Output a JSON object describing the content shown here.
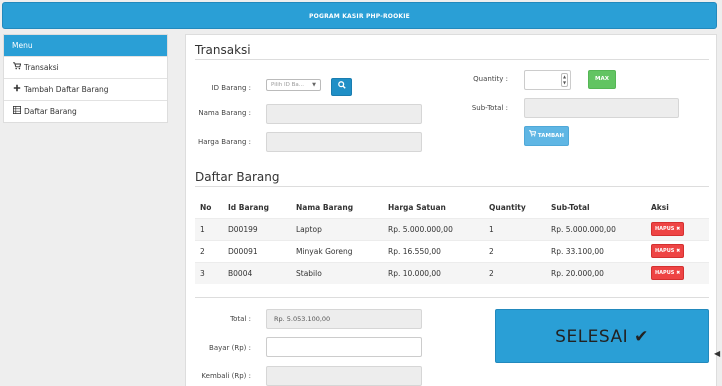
{
  "header": {
    "title": "POGRAM KASIR PHP-ROOKIE"
  },
  "sidebar": {
    "heading": "Menu",
    "items": [
      {
        "label": "Transaksi",
        "icon": "cart-icon"
      },
      {
        "label": "Tambah Daftar Barang",
        "icon": "plus-icon"
      },
      {
        "label": "Daftar Barang",
        "icon": "list-icon"
      }
    ]
  },
  "transaksi": {
    "title": "Transaksi",
    "id_barang_label": "ID Barang :",
    "id_barang_placeholder": "Pilih ID Ba...",
    "nama_barang_label": "Nama Barang :",
    "harga_barang_label": "Harga Barang :",
    "quantity_label": "Quantity :",
    "max_label": "MAX",
    "subtotal_label": "Sub-Total :",
    "tambah_label": "TAMBAH"
  },
  "daftar": {
    "title": "Daftar Barang",
    "columns": [
      "No",
      "Id Barang",
      "Nama Barang",
      "Harga Satuan",
      "Quantity",
      "Sub-Total",
      "Aksi"
    ],
    "rows": [
      {
        "no": "1",
        "id": "D00199",
        "nama": "Laptop",
        "harga": "Rp. 5.000.000,00",
        "qty": "1",
        "subtotal": "Rp. 5.000.000,00",
        "aksi": "HAPUS ✖"
      },
      {
        "no": "2",
        "id": "D00091",
        "nama": "Minyak Goreng",
        "harga": "Rp. 16.550,00",
        "qty": "2",
        "subtotal": "Rp. 33.100,00",
        "aksi": "HAPUS ✖"
      },
      {
        "no": "3",
        "id": "B0004",
        "nama": "Stabilo",
        "harga": "Rp. 10.000,00",
        "qty": "2",
        "subtotal": "Rp. 20.000,00",
        "aksi": "HAPUS ✖"
      }
    ]
  },
  "summary": {
    "total_label": "Total :",
    "total_value": "Rp. 5.053.100,00",
    "bayar_label": "Bayar (Rp) :",
    "kembali_label": "Kembali (Rp) :",
    "selesai_label": "SELESAI ✔"
  },
  "colors": {
    "primary": "#2a9fd6",
    "success": "#62c462",
    "danger": "#ee4444",
    "info": "#5fb6e4"
  }
}
